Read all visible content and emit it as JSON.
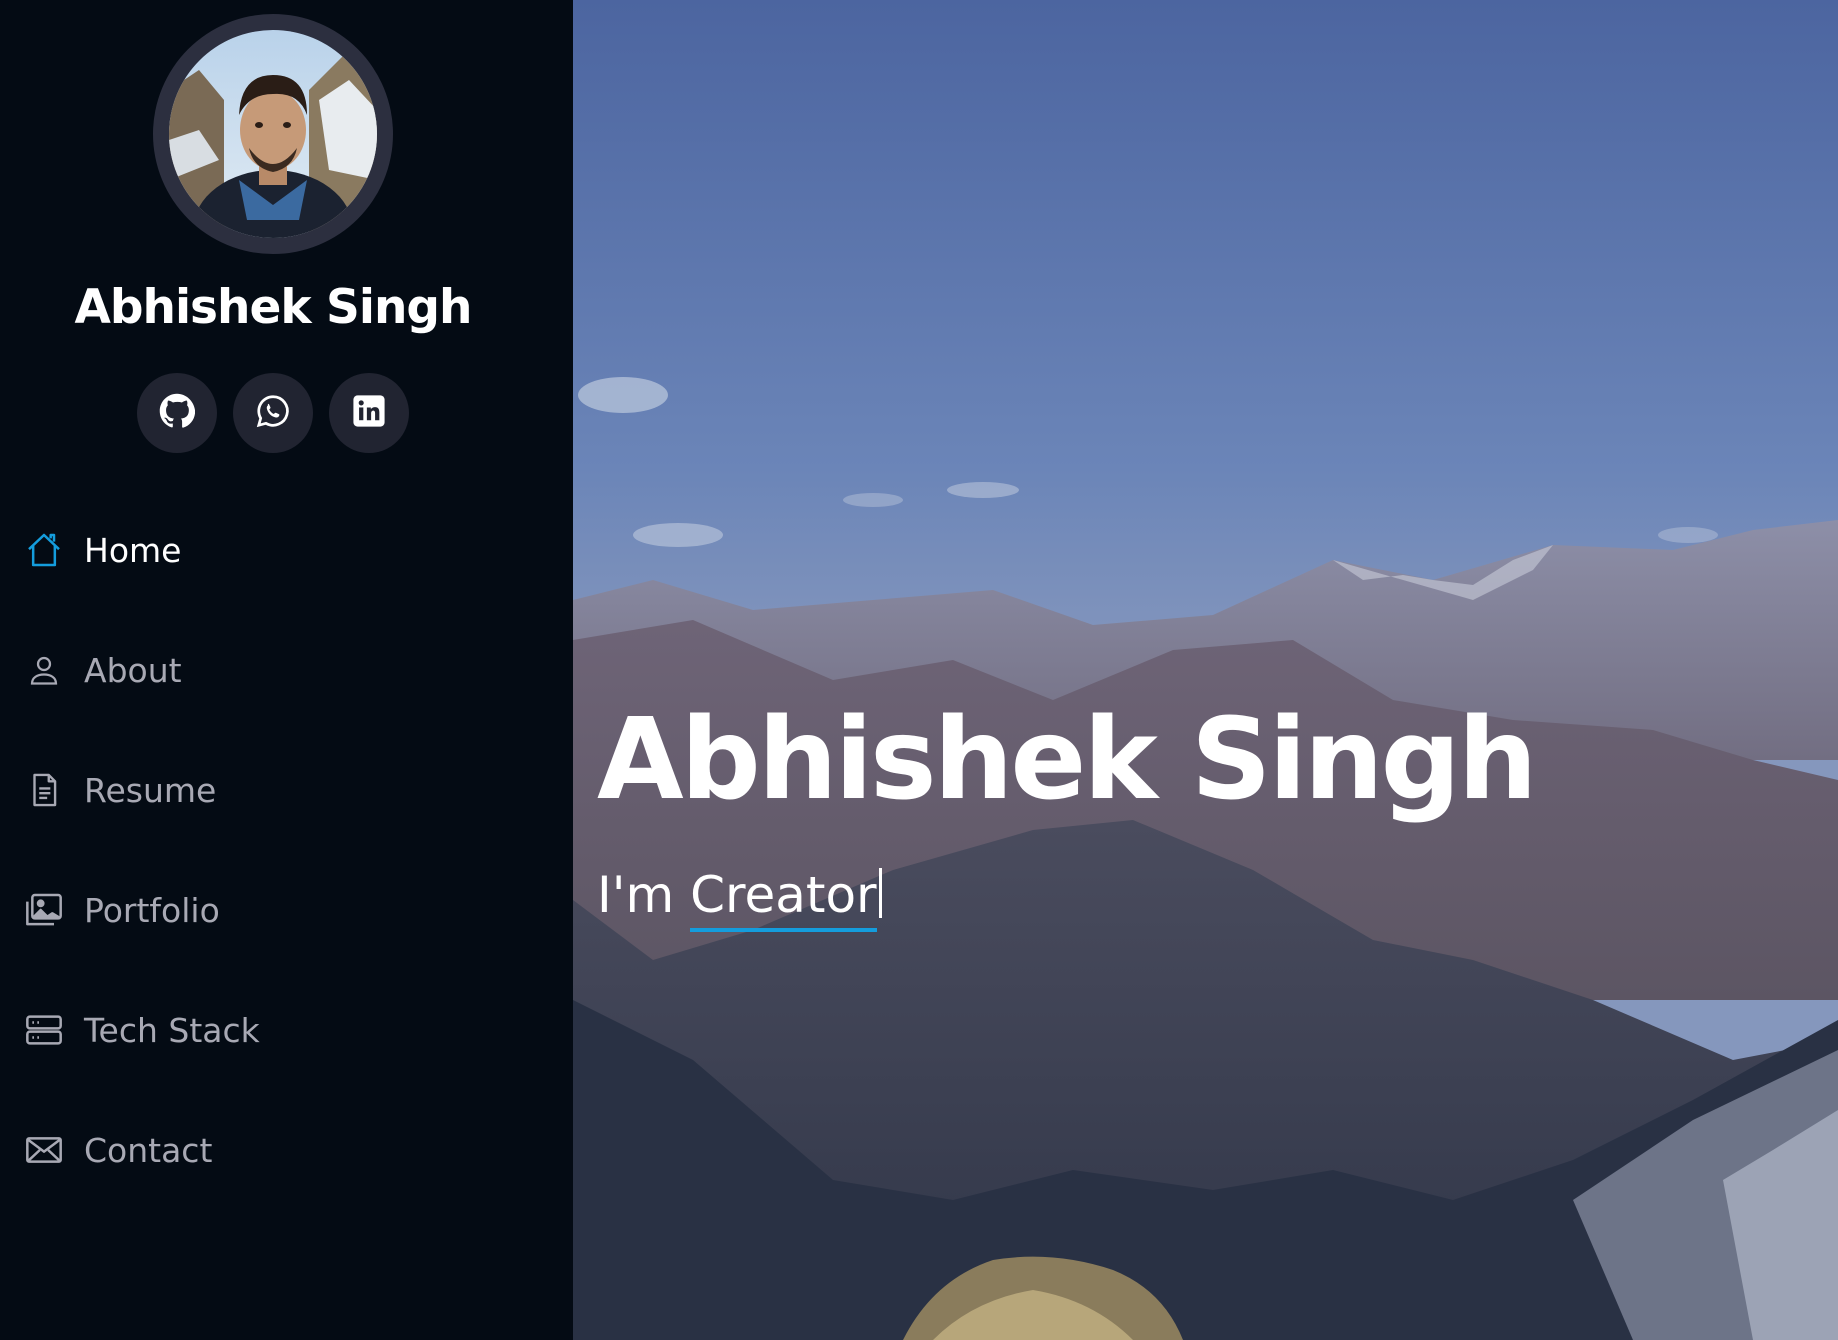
{
  "profile": {
    "name": "Abhishek Singh",
    "avatar_alt": "profile photo"
  },
  "social": [
    {
      "name": "github-icon"
    },
    {
      "name": "whatsapp-icon"
    },
    {
      "name": "linkedin-icon"
    }
  ],
  "nav": {
    "items": [
      {
        "label": "Home",
        "icon": "home-icon",
        "active": true
      },
      {
        "label": "About",
        "icon": "person-icon",
        "active": false
      },
      {
        "label": "Resume",
        "icon": "document-icon",
        "active": false
      },
      {
        "label": "Portfolio",
        "icon": "images-icon",
        "active": false
      },
      {
        "label": "Tech Stack",
        "icon": "server-icon",
        "active": false
      },
      {
        "label": "Contact",
        "icon": "envelope-icon",
        "active": false
      }
    ]
  },
  "hero": {
    "title": "Abhishek Singh",
    "subtitle_prefix": "I'm ",
    "typed_text": "Creator"
  },
  "colors": {
    "accent": "#149ddd",
    "sidebar_bg": "#040b14",
    "social_bg": "#212431",
    "nav_text": "#a8a9b4"
  }
}
